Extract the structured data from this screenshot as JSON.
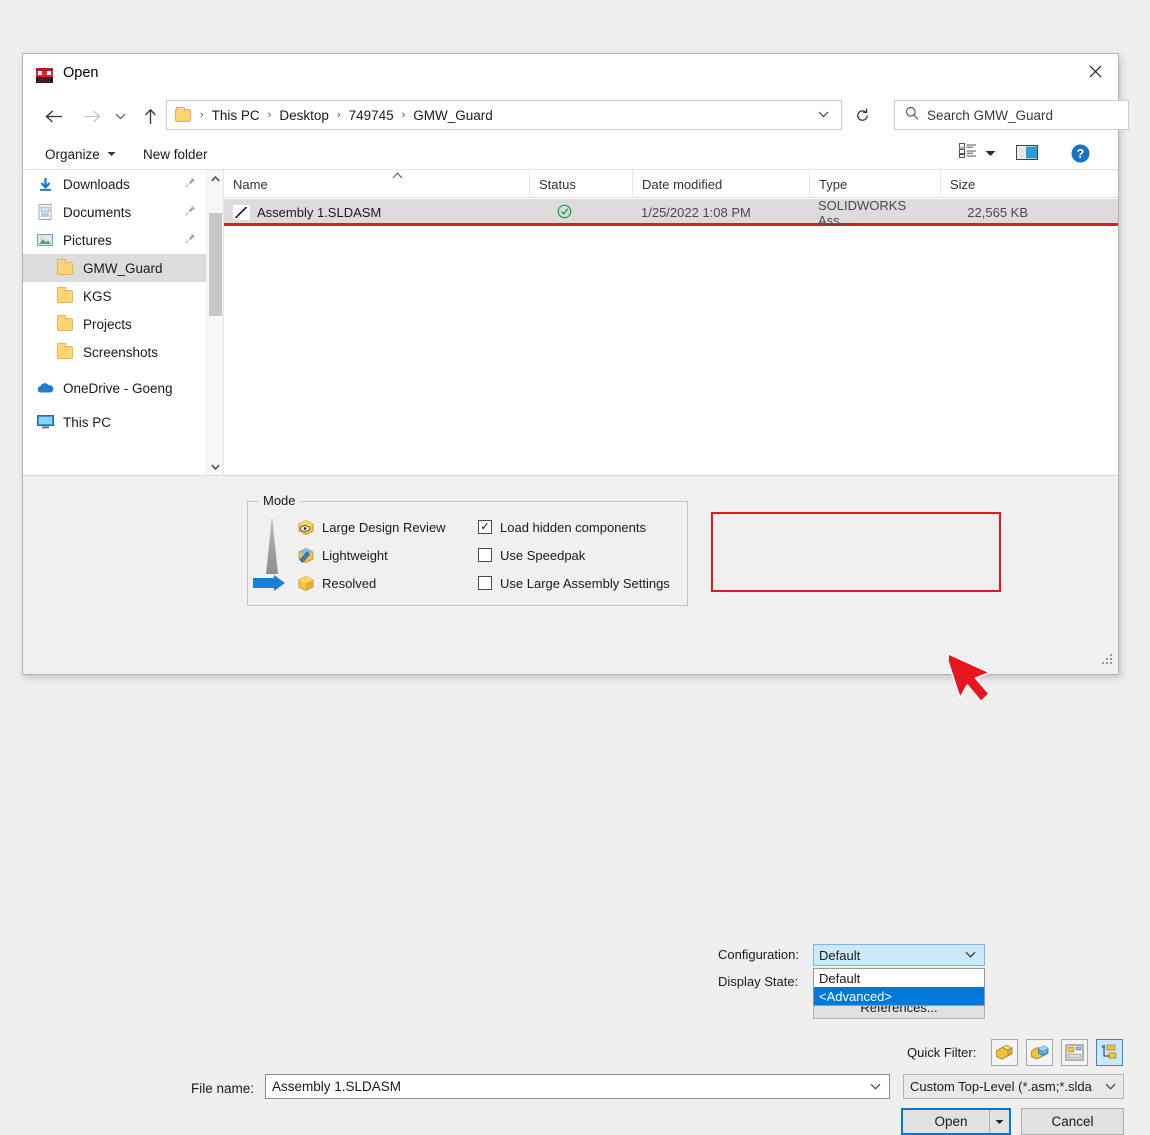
{
  "window": {
    "title": "Open",
    "app_icon": "solidworks-2021-icon",
    "close_label": "✕"
  },
  "nav": {
    "back_icon": "arrow-left-icon",
    "forward_icon": "arrow-right-icon",
    "recent_icon": "chevron-down-icon",
    "up_icon": "arrow-up-icon",
    "refresh_icon": "refresh-icon",
    "breadcrumbs": [
      "This PC",
      "Desktop",
      "749745",
      "GMW_Guard"
    ],
    "separator": "›",
    "address_chevron": "⌄"
  },
  "search": {
    "placeholder": "Search GMW_Guard",
    "icon": "search-icon"
  },
  "command_bar": {
    "organize": "Organize",
    "organize_caret": "▼",
    "new_folder": "New folder",
    "view_mode_icon": "view-list-icon",
    "view_mode_caret": "▼",
    "preview_pane_icon": "preview-pane-icon",
    "help_icon": "help-icon",
    "help_glyph": "?"
  },
  "sidebar": {
    "items": [
      {
        "label": "Downloads",
        "icon": "downloads-icon",
        "pinned": true,
        "indent": false,
        "selected": false
      },
      {
        "label": "Documents",
        "icon": "documents-icon",
        "pinned": true,
        "indent": false,
        "selected": false
      },
      {
        "label": "Pictures",
        "icon": "pictures-icon",
        "pinned": true,
        "indent": false,
        "selected": false
      },
      {
        "label": "GMW_Guard",
        "icon": "folder-icon",
        "pinned": false,
        "indent": true,
        "selected": true
      },
      {
        "label": "KGS",
        "icon": "folder-icon",
        "pinned": false,
        "indent": true,
        "selected": false
      },
      {
        "label": "Projects",
        "icon": "folder-icon",
        "pinned": false,
        "indent": true,
        "selected": false
      },
      {
        "label": "Screenshots",
        "icon": "folder-icon",
        "pinned": false,
        "indent": true,
        "selected": false
      },
      {
        "label": "OneDrive - Goeng",
        "icon": "onedrive-icon",
        "pinned": false,
        "indent": false,
        "selected": false
      },
      {
        "label": "This PC",
        "icon": "this-pc-icon",
        "pinned": false,
        "indent": false,
        "selected": false
      }
    ],
    "pin_glyph": "📌",
    "scroll_up": "⌃",
    "scroll_down": "⌄"
  },
  "file_list": {
    "columns": [
      {
        "key": "name",
        "label": "Name"
      },
      {
        "key": "status",
        "label": "Status"
      },
      {
        "key": "date",
        "label": "Date modified"
      },
      {
        "key": "type",
        "label": "Type"
      },
      {
        "key": "size",
        "label": "Size"
      }
    ],
    "sort_indicator": "⌃",
    "rows": [
      {
        "name": "Assembly 1.SLDASM",
        "status_icon": "cloud-available-check-icon",
        "status_glyph": "⊘",
        "date": "1/25/2022 1:08 PM",
        "type": "SOLIDWORKS Ass...",
        "size": "22,565 KB",
        "selected": true,
        "highlighted": true
      }
    ]
  },
  "mode_group": {
    "legend": "Mode",
    "options": [
      {
        "label": "Large Design Review",
        "icon": "large-design-review-icon",
        "selected": false
      },
      {
        "label": "Lightweight",
        "icon": "lightweight-icon",
        "selected": false
      },
      {
        "label": "Resolved",
        "icon": "resolved-icon",
        "selected": true
      }
    ],
    "pointer_icon": "blue-arrow-pointer-icon",
    "cone_icon": "gradient-cone-icon",
    "checkboxes": [
      {
        "label": "Load hidden components",
        "checked": true,
        "glyph": "✓"
      },
      {
        "label": "Use Speedpak",
        "checked": false,
        "glyph": ""
      },
      {
        "label": "Use Large Assembly Settings",
        "checked": false,
        "glyph": ""
      }
    ]
  },
  "configuration": {
    "label": "Configuration:",
    "selected": "Default",
    "chevron": "⌄",
    "dropdown_open": true,
    "options": [
      {
        "label": "Default",
        "highlighted": false
      },
      {
        "label": "<Advanced>",
        "highlighted": true
      }
    ],
    "highlight_box_color": "#e8161f"
  },
  "display_state": {
    "label": "Display State:"
  },
  "references_button": {
    "label": "References..."
  },
  "quick_filter": {
    "label": "Quick Filter:",
    "buttons": [
      {
        "icon": "filter-part-icon",
        "active": false
      },
      {
        "icon": "filter-assembly-icon",
        "active": false
      },
      {
        "icon": "filter-drawing-icon",
        "active": false
      },
      {
        "icon": "filter-top-level-icon",
        "active": true
      }
    ]
  },
  "file_name": {
    "label": "File name:",
    "value": "Assembly 1.SLDASM",
    "chevron": "⌄"
  },
  "file_type": {
    "value": "Custom Top-Level (*.asm;*.slda",
    "chevron": "⌄"
  },
  "actions": {
    "open_label": "Open",
    "open_split_caret": "▼",
    "cancel_label": "Cancel"
  },
  "annotations": {
    "cursor_icon": "red-arrow-cursor",
    "row_underline_color": "#d81f26",
    "config_box_color": "#e8161f"
  }
}
